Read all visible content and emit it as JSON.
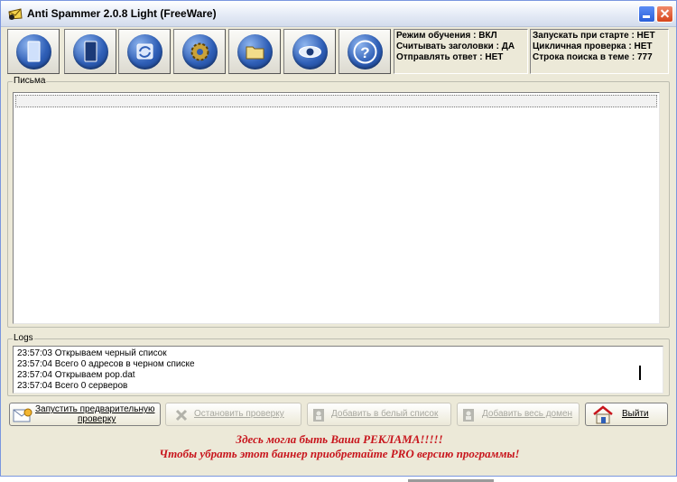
{
  "window": {
    "title": "Anti Spammer 2.0.8 Light (FreeWare)"
  },
  "toolbar": {
    "buttons": [
      {
        "icon": "new-document-icon"
      },
      {
        "icon": "dark-document-icon"
      },
      {
        "icon": "refresh-icon"
      },
      {
        "icon": "gear-icon"
      },
      {
        "icon": "folder-icon"
      },
      {
        "icon": "eye-icon"
      },
      {
        "icon": "help-icon",
        "glyph": "?"
      }
    ]
  },
  "status": {
    "left": [
      "Режим обучения : ВКЛ",
      "Считывать заголовки : ДА",
      "Отправлять ответ : НЕТ"
    ],
    "right": [
      "Запускать при старте : НЕТ",
      "Цикличная проверка : НЕТ",
      "Строка поиска в теме : 777"
    ]
  },
  "letters": {
    "label": "Письма"
  },
  "logs": {
    "label": "Logs",
    "lines": [
      "23:57:03 Открываем черный список",
      "23:57:04 Всего 0 адресов в черном списке",
      "23:57:04 Открываем pop.dat",
      "23:57:04 Всего 0 серверов"
    ]
  },
  "actions": {
    "start_line1": "Запустить предварительную",
    "start_line2": "проверку",
    "stop": "Остановить проверку",
    "whitelist": "Добавить  в белый список",
    "whole_domain": "Добавить весь домен",
    "exit": "Выйти"
  },
  "ad": {
    "line1": "Здесь могла быть Ваша РЕКЛАМА!!!!!",
    "line2": "Чтобы убрать этот баннер приобретайте PRO версию программы!"
  },
  "colors": {
    "accent_red": "#c8161d",
    "button_blue": "#2f5fb7",
    "window_bg": "#ece9d8"
  }
}
